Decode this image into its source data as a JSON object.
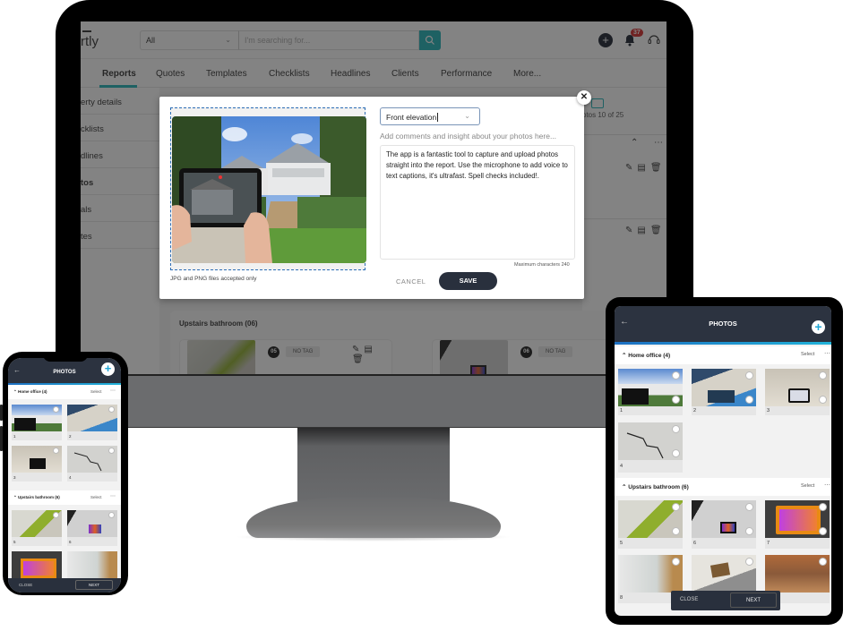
{
  "desktop": {
    "app": {
      "logo_text": "rtly",
      "search": {
        "scope": "All",
        "placeholder": "I'm searching for..."
      },
      "notification_count": "37",
      "nav": [
        "Reports",
        "Quotes",
        "Templates",
        "Checklists",
        "Headlines",
        "Clients",
        "Performance",
        "More..."
      ],
      "active_nav": "Reports",
      "sidebar": [
        "erty details",
        "cklists",
        "dlines",
        "tos",
        "als",
        "tes"
      ],
      "photos_count": "otos 10 of 25",
      "section": {
        "title": "Upstairs bathroom (06)",
        "cards": [
          {
            "number": "05",
            "tag": "NO TAG"
          },
          {
            "number": "06",
            "tag": "NO TAG"
          }
        ]
      }
    },
    "modal": {
      "tag_value": "Front elevation",
      "comment_hint": "Add comments and insight about your photos here...",
      "comment_text": "The app is a fantastic tool to capture and upload photos straight into the report. Use the microphone to add voice to text captions, it's ultrafast. Spell checks included!.",
      "max_chars": "Maximum characters 240",
      "accepted_note": "JPG and PNG files accepted only",
      "cancel_label": "CANCEL",
      "save_label": "SAVE",
      "close_glyph": "✕"
    }
  },
  "tablet": {
    "title": "PHOTOS",
    "sections": [
      {
        "title": "Home office (4)",
        "select": "Select",
        "photos": [
          "1",
          "2",
          "3",
          "4"
        ]
      },
      {
        "title": "Upstairs bathroom (6)",
        "select": "Select",
        "photos": [
          "5",
          "6",
          "7",
          "8"
        ]
      }
    ],
    "close_label": "CLOSE",
    "next_label": "NEXT"
  },
  "phone": {
    "title": "PHOTOS",
    "sections": [
      {
        "title": "Home office (4)",
        "select": "Select",
        "photos": [
          "1",
          "2",
          "3",
          "4"
        ]
      },
      {
        "title": "Upstairs bathroom (6)",
        "select": "Select",
        "photos": [
          "5",
          "6"
        ]
      }
    ],
    "close_label": "CLOSE",
    "next_label": "NEXT"
  },
  "colors": {
    "accent": "#21b3b9",
    "dark": "#29303d",
    "badge": "#d62a2a"
  }
}
